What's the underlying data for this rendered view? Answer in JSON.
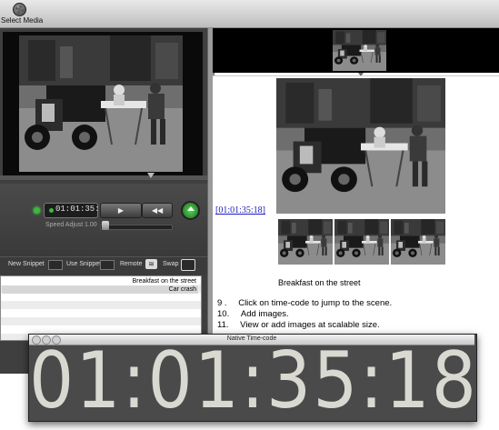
{
  "toolbar": {
    "select_media_label": "Select Media",
    "select_media_icon": "film-reel-icon"
  },
  "player": {
    "timecode": "01:01:35:18",
    "play_symbol": "▶",
    "rewind_symbol": "◀◀",
    "speed_adjust_label": "Speed Adjust",
    "speed_value": "1.00"
  },
  "snippet_bar": {
    "new_snippet": "New Snippet",
    "use_snippet": "Use Snippet",
    "remote": "Remote",
    "swap": "Swap"
  },
  "snippets": [
    "Breakfast on the street",
    "Car crash"
  ],
  "document": {
    "timecode_link": "[01:01:35:18]",
    "caption": "Breakfast on the street",
    "lines": [
      {
        "num": "9 .",
        "text": "Click on time-code to jump to the scene."
      },
      {
        "num": "10.",
        "text": "Add images."
      },
      {
        "num": "11.",
        "text": "View or add images at scalable size."
      }
    ]
  },
  "timecode_window": {
    "title": "Native Time-code",
    "value": "01:01:35:18"
  },
  "colors": {
    "accent_green": "#3db83d",
    "link_blue": "#1a1abf",
    "panel_dark": "#3f3f3f"
  }
}
